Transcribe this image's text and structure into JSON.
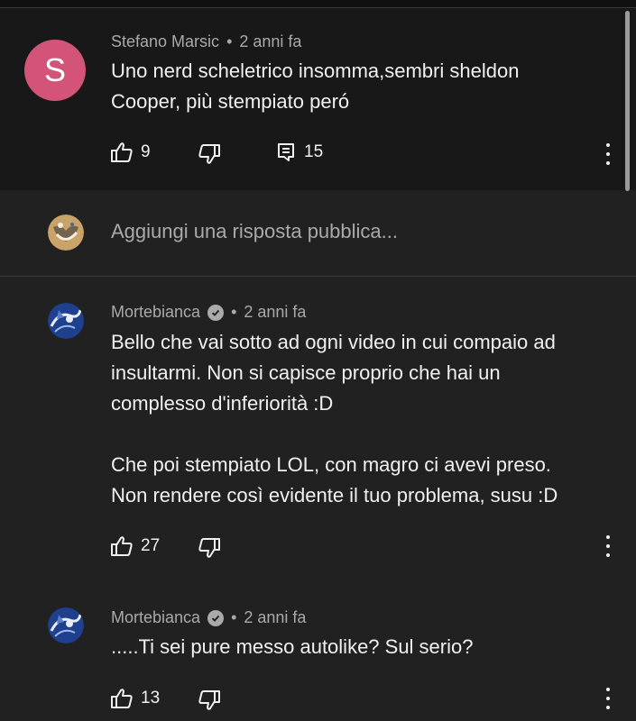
{
  "parent_comment": {
    "avatar_letter": "S",
    "avatar_color": "#d45378",
    "author": "Stefano Marsic",
    "time": "2 anni fa",
    "text": "Uno nerd scheletrico insomma,sembri sheldon\nCooper, più stempiato peró",
    "likes": "9",
    "replies": "15"
  },
  "reply_box": {
    "placeholder": "Aggiungi una risposta pubblica..."
  },
  "replies": [
    {
      "author": "Mortebianca",
      "verified": true,
      "time": "2 anni fa",
      "text": "Bello che vai sotto ad ogni video in cui compaio ad\ninsultarmi. Non si capisce proprio che hai un\ncomplesso d'inferiorità :D\n\nChe poi stempiato LOL, con magro ci avevi preso.\nNon rendere così evidente il tuo problema, susu :D",
      "likes": "27"
    },
    {
      "author": "Mortebianca",
      "verified": true,
      "time": "2 anni fa",
      "text": ".....Ti sei pure messo autolike? Sul serio?",
      "likes": "13"
    }
  ],
  "icons": {
    "like": "thumb-up-icon",
    "dislike": "thumb-down-icon",
    "reply": "comment-icon",
    "menu": "more-vert-icon",
    "verified": "verified-check-icon"
  }
}
